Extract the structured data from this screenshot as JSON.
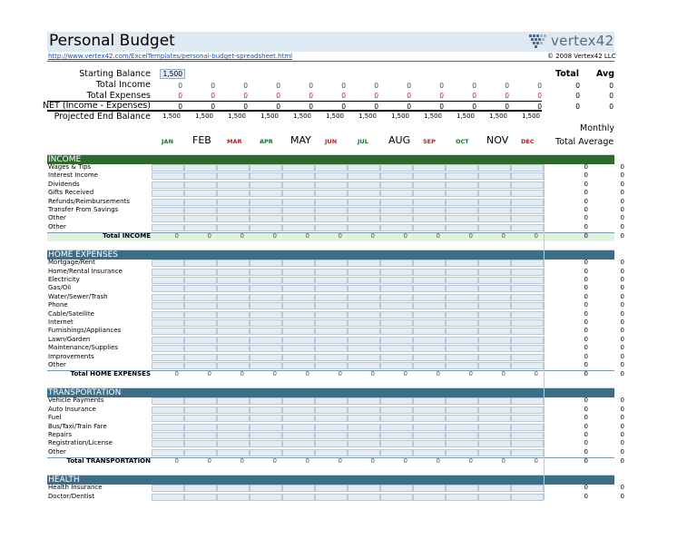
{
  "header": {
    "title": "Personal Budget",
    "url": "http://www.vertex42.com/ExcelTemplates/personal-budget-spreadsheet.html",
    "copyright": "© 2008 Vertex42 LLC",
    "logo_text": "vertex42"
  },
  "summary": {
    "labels": [
      "Starting Balance",
      "Total Income",
      "Total Expenses",
      "NET (Income - Expenses)",
      "Projected End Balance"
    ],
    "starting_balance": "1,500",
    "month_values": [
      "0",
      "0",
      "0",
      "0",
      "0",
      "0",
      "0",
      "0",
      "0",
      "0",
      "0",
      "0"
    ],
    "end_balances": [
      "1,500",
      "1,500",
      "1,500",
      "1,500",
      "1,500",
      "1,500",
      "1,500",
      "1,500",
      "1,500",
      "1,500",
      "1,500",
      "1,500"
    ],
    "total_header": "Total",
    "avg_header": "Avg",
    "zero": "0"
  },
  "months": [
    "JAN",
    "FEB",
    "MAR",
    "APR",
    "MAY",
    "JUN",
    "JUL",
    "AUG",
    "SEP",
    "OCT",
    "NOV",
    "DEC"
  ],
  "month_colors": [
    "#0a7a1e",
    "#000000",
    "#c11c1c",
    "#0a7a1e",
    "#000000",
    "#c11c1c",
    "#0a7a1e",
    "#000000",
    "#c11c1c",
    "#0a7a1e",
    "#000000",
    "#c11c1c"
  ],
  "month_big": [
    false,
    true,
    false,
    false,
    true,
    false,
    false,
    true,
    false,
    false,
    true,
    false
  ],
  "right_headers": {
    "monthly": "Monthly",
    "total_average": "Total Average"
  },
  "sections": [
    {
      "title": "INCOME",
      "color": "#2e6b2a",
      "items": [
        "Wages & Tips",
        "Interest Income",
        "Dividends",
        "Gifts Received",
        "Refunds/Reimbursements",
        "Transfer From Savings",
        "Other",
        "Other"
      ],
      "total_label": "Total INCOME",
      "total_bg": "#e3f1df"
    },
    {
      "title": "HOME EXPENSES",
      "color": "#3d6e87",
      "items": [
        "Mortgage/Rent",
        "Home/Rental Insurance",
        "Electricity",
        "Gas/Oil",
        "Water/Sewer/Trash",
        "Phone",
        "Cable/Satellite",
        "Internet",
        "Furnishings/Appliances",
        "Lawn/Garden",
        "Maintenance/Supplies",
        "Improvements",
        "Other"
      ],
      "total_label": "Total HOME EXPENSES",
      "total_bg": "#ffffff"
    },
    {
      "title": "TRANSPORTATION",
      "color": "#3d6e87",
      "items": [
        "Vehicle Payments",
        "Auto Insurance",
        "Fuel",
        "Bus/Taxi/Train Fare",
        "Repairs",
        "Registration/License",
        "Other"
      ],
      "total_label": "Total TRANSPORTATION",
      "total_bg": "#ffffff"
    },
    {
      "title": "HEALTH",
      "color": "#3d6e87",
      "items": [
        "Health Insurance",
        "Doctor/Dentist"
      ],
      "total_label": "",
      "total_bg": "#ffffff"
    }
  ]
}
